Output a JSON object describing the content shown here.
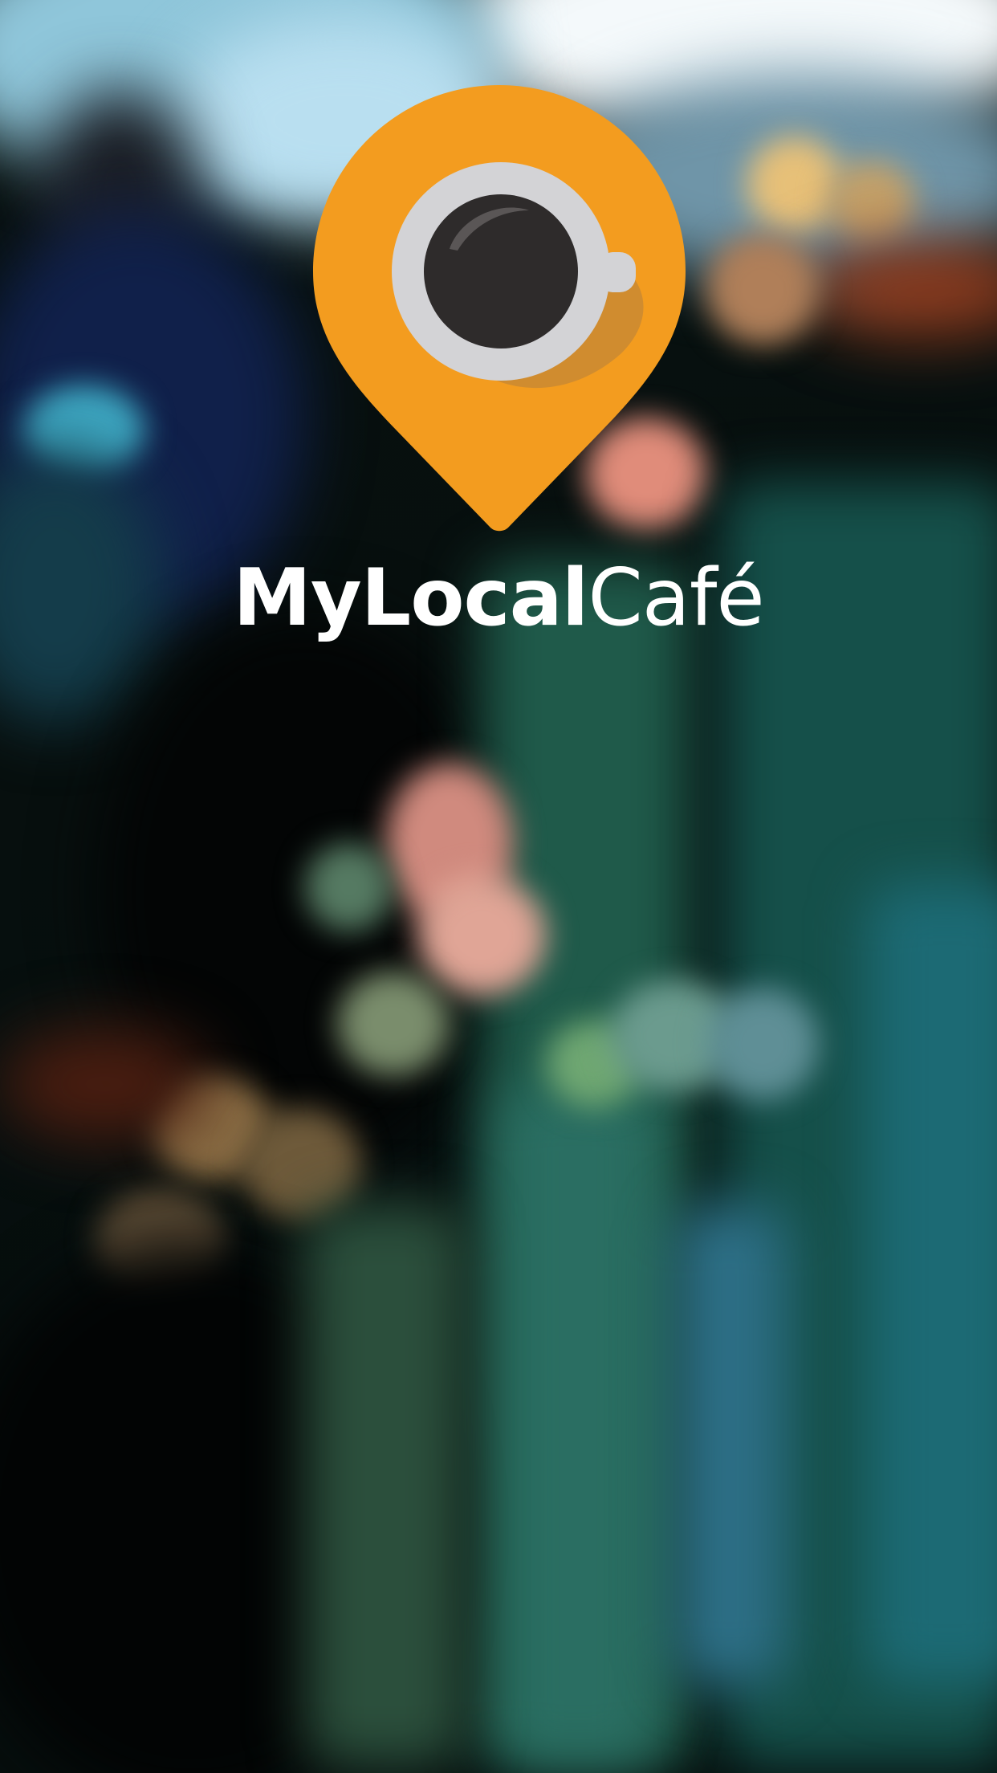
{
  "app": {
    "brand_bold": "MyLocal",
    "brand_light": "Café"
  },
  "colors": {
    "pin": "#F39C1F",
    "pin_shadow": "#C97F10",
    "cup_ring": "#D3D3D6",
    "coffee": "#2E2B2B",
    "text": "#FFFFFF"
  },
  "icons": {
    "logo": "map-pin-coffee-cup-icon"
  }
}
